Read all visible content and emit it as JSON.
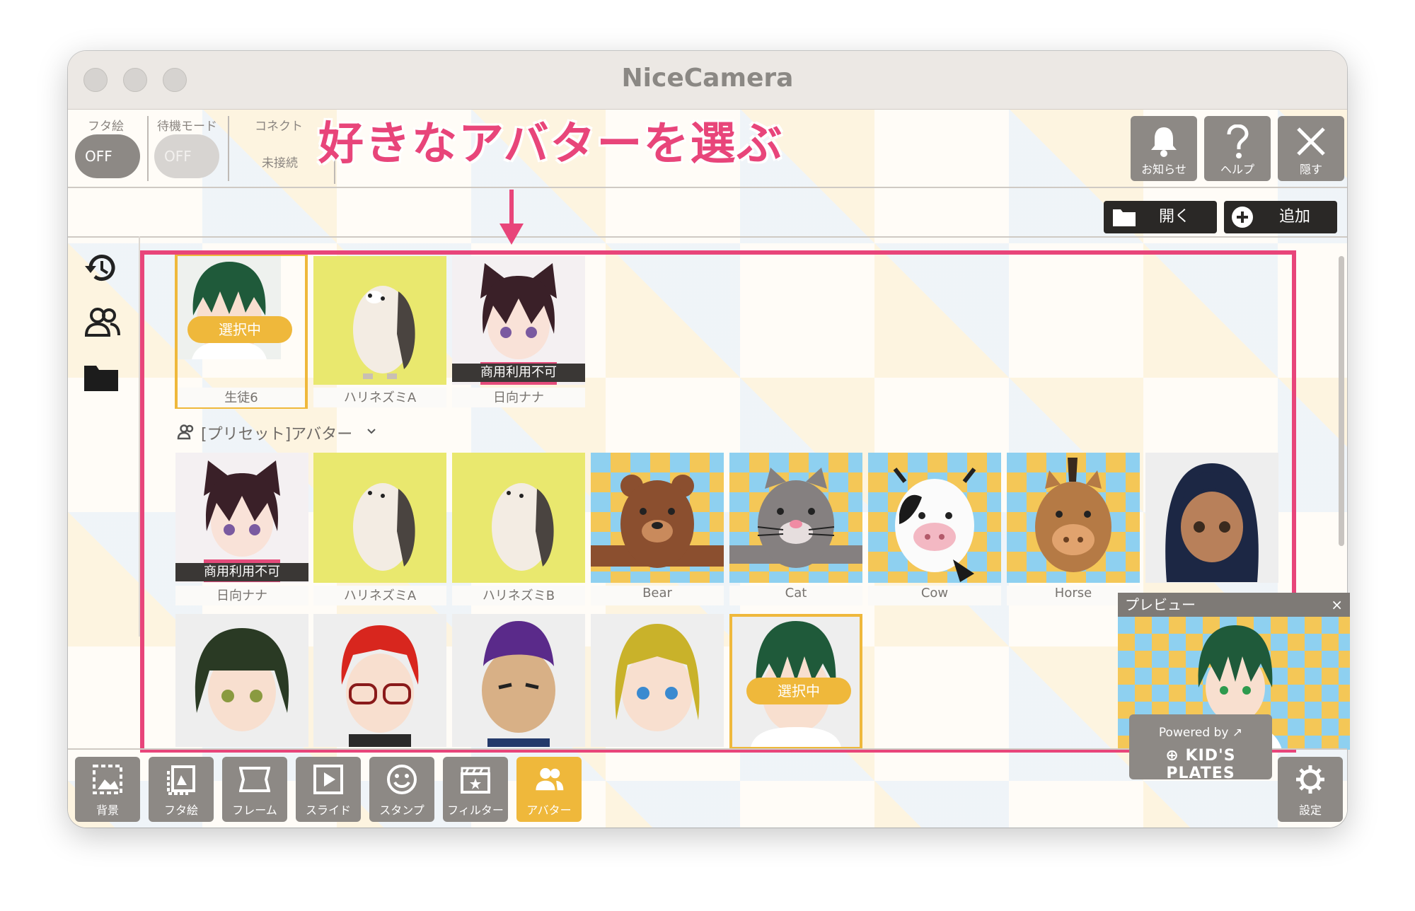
{
  "window": {
    "title": "NiceCamera"
  },
  "toolbar": {
    "futae_label": "フタ絵",
    "futae_state": "OFF",
    "standby_label": "待機モード",
    "standby_state": "OFF",
    "connect_label": "コネクト",
    "connect_status": "未接続",
    "notify_label": "お知らせ",
    "help_label": "ヘルプ",
    "hide_label": "隠す"
  },
  "annotation": {
    "headline": "好きなアバターを選ぶ"
  },
  "actions": {
    "open_label": "開く",
    "add_label": "追加"
  },
  "recent": {
    "items": [
      {
        "name": "生徒6",
        "badge": "選択中"
      },
      {
        "name": "ハリネズミA"
      },
      {
        "name": "日向ナナ",
        "tag": "商用利用不可"
      }
    ]
  },
  "preset": {
    "header": "[プリセット]アバター",
    "row1": [
      {
        "name": "日向ナナ",
        "tag": "商用利用不可"
      },
      {
        "name": "ハリネズミA"
      },
      {
        "name": "ハリネズミB"
      },
      {
        "name": "Bear"
      },
      {
        "name": "Cat"
      },
      {
        "name": "Cow"
      },
      {
        "name": "Horse"
      }
    ],
    "row2_selected_badge": "選択中"
  },
  "preview": {
    "title": "プレビュー",
    "close": "×"
  },
  "bottom": {
    "tabs": [
      "背景",
      "フタ絵",
      "フレーム",
      "スライド",
      "スタンプ",
      "フィルター",
      "アバター"
    ],
    "powered_by": "Powered by",
    "brand": "KID'S PLATES",
    "settings_label": "設定"
  },
  "colors": {
    "accent_pink": "#e8457a",
    "accent_yellow": "#efb83b",
    "button_gray": "#8d8985"
  }
}
